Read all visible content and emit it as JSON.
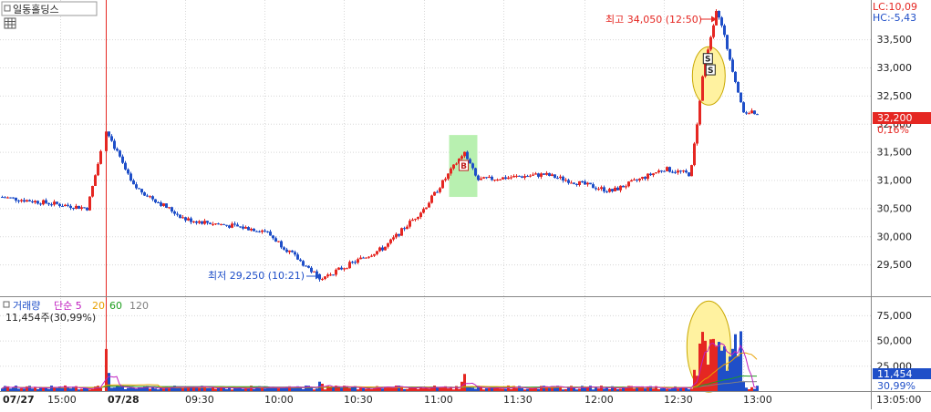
{
  "toolbar": {
    "symbol": "일동홀딩스",
    "table_icon": "table-icon",
    "box_icon": "checkbox-icon"
  },
  "colors": {
    "up": "#E52722",
    "down": "#1F4FC8",
    "grid": "#D8D8D8",
    "ma5": "#C020C0",
    "ma20": "#E8A000",
    "ma60": "#1E9E1E",
    "ma120": "#808080",
    "highlight": "#FFF2A0",
    "signal_box": "#B8F0B0"
  },
  "chart_data": [
    {
      "type": "candlestick",
      "panel": "price",
      "time_range": [
        "07/27 14:00",
        "07/28 13:00"
      ],
      "y_ticks": [
        29500,
        30000,
        30500,
        31000,
        31500,
        32000,
        32500,
        33000,
        33500
      ],
      "y_tick_labels": [
        "29,500",
        "30,000",
        "30,500",
        "31,000",
        "31,500",
        "32,000",
        "32,500",
        "33,000",
        "33,500"
      ],
      "ylim": [
        29000,
        34150
      ],
      "indicators": {
        "lc": "LC:10,09",
        "hc": "HC:-5,43"
      },
      "current": {
        "price": "32,200",
        "change": "0,16%"
      },
      "annotations": {
        "high": "최고 34,050 (12:50)",
        "low": "최저 29,250 (10:21)",
        "signal_b": "B",
        "signal_s": "S"
      },
      "key_points": [
        {
          "time": "07/27 14:00",
          "price": 30700
        },
        {
          "time": "07/27 15:20",
          "price": 30500
        },
        {
          "time": "07/28 09:00",
          "price": 31900
        },
        {
          "time": "07/28 09:10",
          "price": 30900
        },
        {
          "time": "07/28 09:30",
          "price": 30300
        },
        {
          "time": "07/28 10:00",
          "price": 30100
        },
        {
          "time": "07/28 10:21",
          "price": 29250
        },
        {
          "time": "07/28 10:45",
          "price": 29800
        },
        {
          "time": "07/28 11:00",
          "price": 30500
        },
        {
          "time": "07/28 11:15",
          "price": 31500
        },
        {
          "time": "07/28 11:20",
          "price": 31000
        },
        {
          "time": "07/28 11:45",
          "price": 31100
        },
        {
          "time": "07/28 12:10",
          "price": 30800
        },
        {
          "time": "07/28 12:30",
          "price": 31200
        },
        {
          "time": "07/28 12:40",
          "price": 31100
        },
        {
          "time": "07/28 12:45",
          "price": 33000
        },
        {
          "time": "07/28 12:50",
          "price": 34050
        },
        {
          "time": "07/28 13:00",
          "price": 32200
        }
      ]
    },
    {
      "type": "bar",
      "panel": "volume",
      "legend": [
        {
          "label": "거래량",
          "color": "#1F4FC8"
        },
        {
          "label": "단순 5",
          "color": "#C020C0"
        },
        {
          "label": "20",
          "color": "#E8A000"
        },
        {
          "label": "60",
          "color": "#1E9E1E"
        },
        {
          "label": "120",
          "color": "#808080"
        }
      ],
      "current_text": "11,454주(30,99%)",
      "current_value": "11,454",
      "current_pct": "30,99%",
      "y_ticks": [
        25000,
        50000,
        75000
      ],
      "y_tick_labels": [
        "25,000",
        "50,000",
        "75,000"
      ],
      "ylim": [
        0,
        92000
      ],
      "key_points": [
        {
          "time": "07/28 09:00",
          "volume": 55000
        },
        {
          "time": "07/28 10:21",
          "volume": 16000
        },
        {
          "time": "07/28 11:15",
          "volume": 20000
        },
        {
          "time": "07/28 12:45",
          "volume": 70000
        },
        {
          "time": "07/28 12:48",
          "volume": 88000
        },
        {
          "time": "07/28 12:50",
          "volume": 75000
        },
        {
          "time": "07/28 13:00",
          "volume": 11454
        }
      ]
    }
  ],
  "x_axis": {
    "labels": [
      "07/27",
      "15:00",
      "07/28",
      "09:30",
      "10:00",
      "10:30",
      "11:00",
      "11:30",
      "12:00",
      "12:30",
      "13:00"
    ],
    "right_label": "13:05:00"
  }
}
